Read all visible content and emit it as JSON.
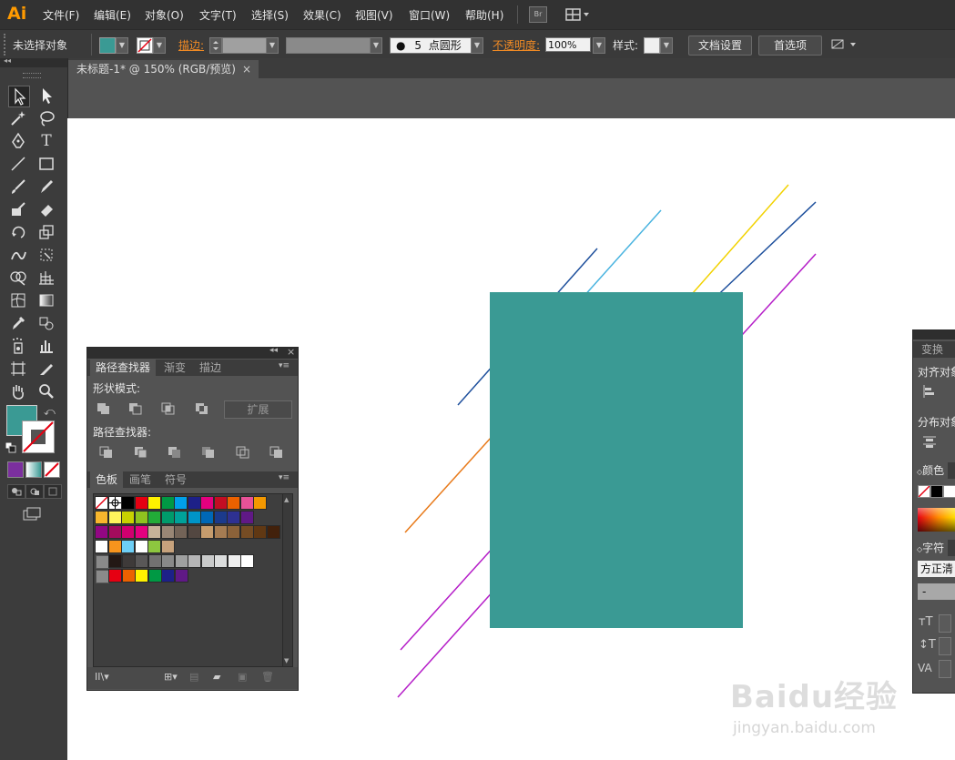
{
  "app": {
    "logo": "Ai"
  },
  "menu": [
    "文件(F)",
    "编辑(E)",
    "对象(O)",
    "文字(T)",
    "选择(S)",
    "效果(C)",
    "视图(V)",
    "窗口(W)",
    "帮助(H)"
  ],
  "menubar_buttons": {
    "bridge": "Br"
  },
  "control_bar": {
    "selection_status": "未选择对象",
    "stroke_label": "描边:",
    "brush_size": "5",
    "brush_label": "点圆形",
    "opacity_label": "不透明度:",
    "opacity_value": "100%",
    "style_label": "样式:",
    "doc_settings": "文档设置",
    "preferences": "首选项"
  },
  "document": {
    "tab_title": "未标题-1* @ 150% (RGB/预览)",
    "close": "×"
  },
  "pathfinder_panel": {
    "tabs": [
      "路径查找器",
      "渐变",
      "描边"
    ],
    "shape_modes_label": "形状模式:",
    "expand_button": "扩展",
    "pathfinders_label": "路径查找器:"
  },
  "swatches_panel": {
    "tabs": [
      "色板",
      "画笔",
      "符号"
    ],
    "rows": [
      [
        "#ffffff",
        "#ffffff",
        "#000000",
        "#e60012",
        "#fff100",
        "#009944",
        "#00a0e9",
        "#1d2088",
        "#e4007f",
        "#c30d23",
        "#eb6100",
        "#e85298",
        "#f39800"
      ],
      [
        "#f8b62d",
        "#fff45c",
        "#c9d200",
        "#8fc31f",
        "#22ac38",
        "#009b6b",
        "#00a29a",
        "#0094c8",
        "#0068b7",
        "#1b3a8c",
        "#2e3192",
        "#601986"
      ],
      [
        "#920783",
        "#a40b5d",
        "#d1006f",
        "#e4007f",
        "#c7b299",
        "#998675",
        "#736357",
        "#534741",
        "#c69c6d",
        "#a67c52",
        "#8c6239",
        "#754c24",
        "#603813",
        "#42210b"
      ],
      [
        "#ffffff",
        "#f7941d",
        "#6dcff6",
        "#ffffff",
        "#8dc63f",
        "#c7a27c"
      ],
      [
        "#231815",
        "#3e3a39",
        "#595757",
        "#727171",
        "#898989",
        "#9fa0a0",
        "#b5b5b6",
        "#c9caca",
        "#dcdddd",
        "#efefef",
        "#ffffff"
      ],
      [
        "#e60012",
        "#eb6100",
        "#fff100",
        "#009944",
        "#1d2088",
        "#601986"
      ]
    ]
  },
  "right_panel": {
    "transform_tab": "变换",
    "align_label": "对齐对象",
    "distribute_label": "分布对象",
    "color_tab": "颜色",
    "char_tab": "字符",
    "font_name": "方正清",
    "font_style": "-"
  },
  "canvas": {
    "rect_color": "#3a9a94",
    "watermark": "Baidu经验",
    "watermark_url": "jingyan.baidu.com"
  }
}
